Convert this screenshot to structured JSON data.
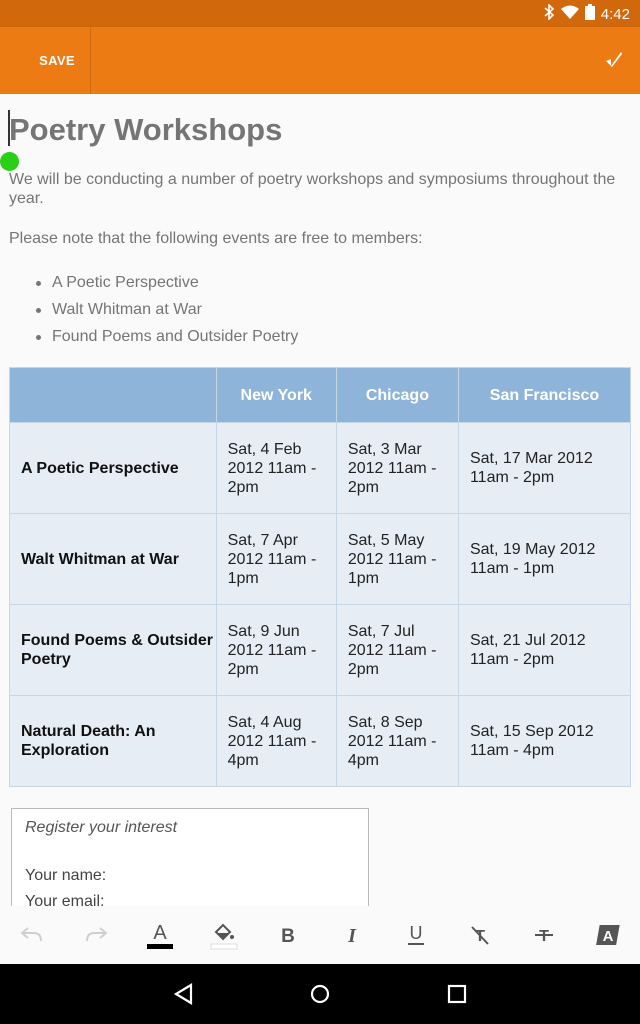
{
  "status_bar": {
    "time": "4:42",
    "icons": [
      "bluetooth-icon",
      "wifi-icon",
      "battery-icon"
    ]
  },
  "app_bar": {
    "save_label": "SAVE",
    "done_icon": "checkmark-pen-icon",
    "color": "#ec7b13"
  },
  "document": {
    "title": "Poetry Workshops",
    "intro": "We will be conducting a number of poetry workshops and symposiums throughout the year.",
    "note": "Please note that the following events are free to members:",
    "bullets": [
      "A Poetic Perspective",
      "Walt Whitman at War",
      "Found Poems and Outsider Poetry"
    ],
    "table": {
      "headers": [
        "",
        "New York",
        "Chicago",
        "San Francisco"
      ],
      "rows": [
        {
          "label": "A Poetic Perspective",
          "cells": [
            "Sat, 4 Feb 2012 11am - 2pm",
            "Sat, 3 Mar 2012 11am - 2pm",
            "Sat, 17 Mar 2012 11am - 2pm"
          ]
        },
        {
          "label": "Walt Whitman at War",
          "cells": [
            "Sat, 7 Apr 2012 11am - 1pm",
            "Sat, 5 May 2012 11am - 1pm",
            "Sat, 19 May 2012 11am - 1pm"
          ]
        },
        {
          "label": "Found Poems & Outsider Poetry",
          "cells": [
            "Sat, 9 Jun 2012 11am - 2pm",
            "Sat, 7 Jul 2012 11am - 2pm",
            "Sat, 21 Jul 2012 11am - 2pm"
          ]
        },
        {
          "label": "Natural Death: An Exploration",
          "cells": [
            "Sat, 4 Aug 2012 11am - 4pm",
            "Sat, 8 Sep 2012 11am - 4pm",
            "Sat, 15 Sep 2012 11am - 4pm"
          ]
        }
      ]
    },
    "register": {
      "title": "Register your interest",
      "name_label": "Your name:",
      "email_label": "Your email:"
    }
  },
  "toolbar": {
    "items": [
      "undo-icon",
      "redo-icon",
      "text-color-icon",
      "fill-color-icon",
      "bold-icon",
      "italic-icon",
      "underline-icon",
      "clear-format-icon",
      "strikethrough-icon",
      "text-style-icon"
    ],
    "text_color": "#000000",
    "fill_color": "#ffffff"
  }
}
